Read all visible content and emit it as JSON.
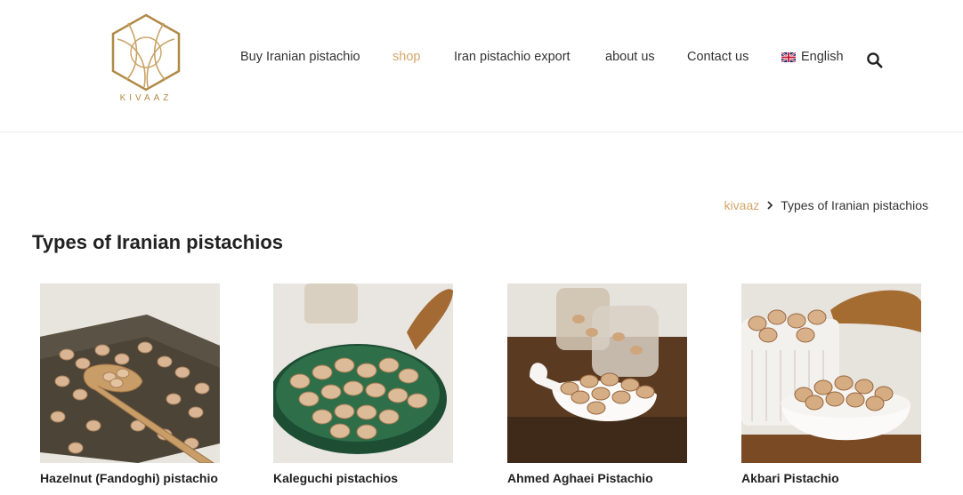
{
  "logo": {
    "text": "KIVAAZ",
    "icon": "hexagon-logo-icon",
    "color": "#b08a47"
  },
  "nav": {
    "items": [
      {
        "label": "Buy Iranian pistachio",
        "active": false
      },
      {
        "label": "shop",
        "active": true
      },
      {
        "label": "Iran pistachio export",
        "active": false
      },
      {
        "label": "about us",
        "active": false
      },
      {
        "label": "Contact us",
        "active": false
      }
    ],
    "language": {
      "label": "English",
      "icon": "uk-flag-icon"
    },
    "search_icon": "search-icon"
  },
  "breadcrumb": {
    "home": "kivaaz",
    "separator_icon": "chevron-right-icon",
    "current": "Types of Iranian pistachios"
  },
  "page": {
    "title": "Types of Iranian pistachios"
  },
  "products": [
    {
      "name": "Hazelnut (Fandoghi) pistachio"
    },
    {
      "name": "Kaleguchi pistachios"
    },
    {
      "name": "Ahmed Aghaei Pistachio"
    },
    {
      "name": "Akbari Pistachio"
    }
  ],
  "colors": {
    "accent": "#d4a66a",
    "text": "#333333",
    "title": "#222222"
  }
}
